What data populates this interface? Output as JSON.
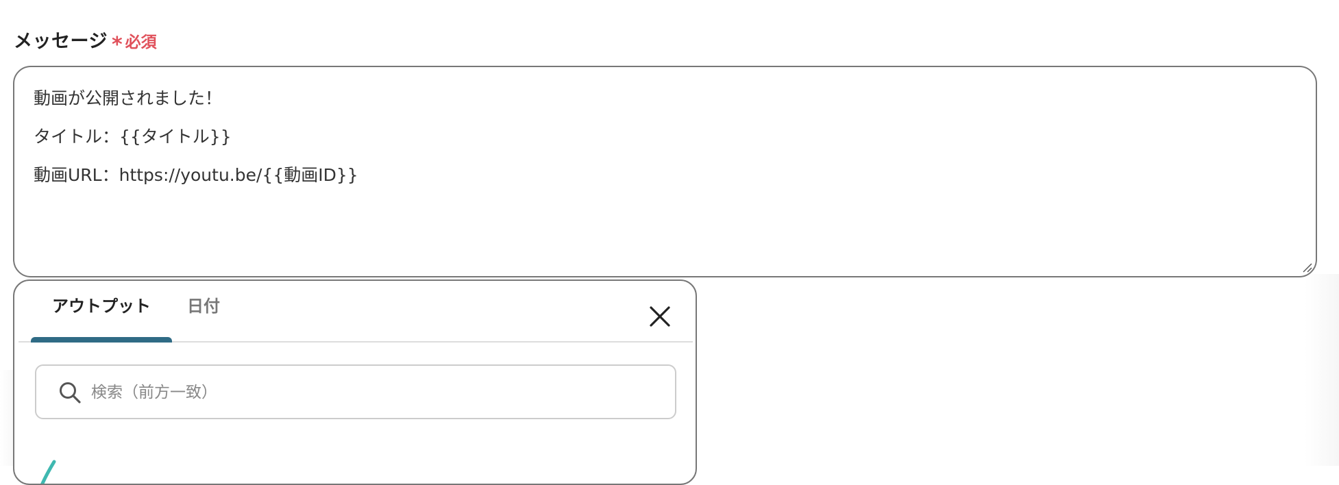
{
  "field": {
    "label": "メッセージ",
    "required_mark": "*",
    "required_text": "必須"
  },
  "message": {
    "lines": [
      "動画が公開されました！",
      "タイトル：{{タイトル}}",
      "動画URL：https://youtu.be/{{動画ID}}"
    ]
  },
  "popup": {
    "tabs": [
      {
        "label": "アウトプット",
        "active": true
      },
      {
        "label": "日付",
        "active": false
      }
    ],
    "close_icon": "close-icon",
    "search": {
      "placeholder": "検索（前方一致）",
      "value": "",
      "icon": "search-icon"
    }
  },
  "colors": {
    "required": "#e0505a",
    "tab_accent": "#2f6b85",
    "border": "#777777",
    "teal_glyph": "#3fb8b0"
  }
}
